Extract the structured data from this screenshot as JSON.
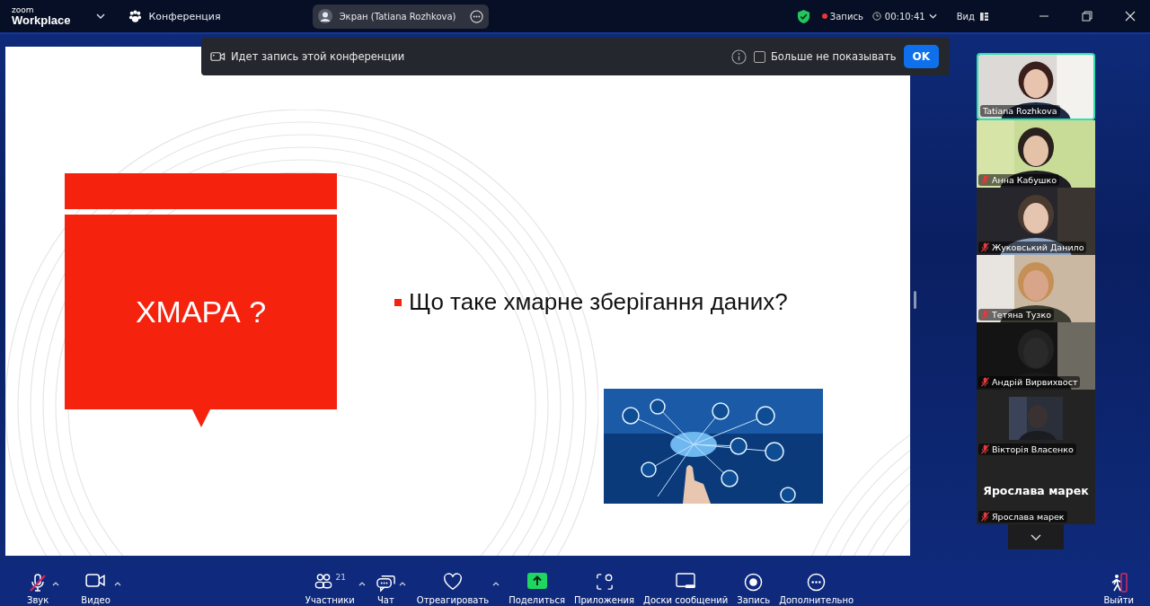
{
  "top_bar": {
    "logo_small": "zoom",
    "logo": "Workplace",
    "meeting_label": "Конференция",
    "share_pill": "Экран (Tatiana Rozhkova)",
    "recording": "Запись",
    "timer": "00:10:41",
    "view": "Вид"
  },
  "notice": {
    "text": "Идет запись этой конференции",
    "checkbox": {
      "label": "Больше не показывать",
      "checked": false
    },
    "button": "OK"
  },
  "slide": {
    "title": "ХМАРА ?",
    "bullet": "Що таке хмарне зберігання даних?"
  },
  "participants": [
    {
      "name": "Tatiana Rozhkova",
      "kind": "video",
      "muted": false,
      "speaking": true
    },
    {
      "name": "Анна Кабушко",
      "kind": "video",
      "muted": true,
      "speaking": false
    },
    {
      "name": "Жуковський Данило",
      "kind": "video",
      "muted": true,
      "speaking": false
    },
    {
      "name": "Тетяна Тузко",
      "kind": "video",
      "muted": true,
      "speaking": false
    },
    {
      "name": "Андрій Вирвихвост",
      "kind": "video",
      "muted": true,
      "speaking": false
    },
    {
      "name": "Вікторія Власенко",
      "kind": "thumbnail",
      "muted": true,
      "speaking": false
    },
    {
      "name": "Ярослава марек",
      "kind": "name",
      "display_name": "Ярослава марек",
      "muted": true,
      "speaking": false
    }
  ],
  "toolbar": [
    {
      "kind": "mic",
      "label": "Звук",
      "muted": true,
      "menu": true
    },
    {
      "kind": "video",
      "label": "Видео",
      "menu": true
    },
    {
      "kind": "participants",
      "label": "Участники",
      "count": "21",
      "menu": true
    },
    {
      "kind": "chat",
      "label": "Чат",
      "menu": true
    },
    {
      "kind": "react",
      "label": "Отреагировать",
      "menu": true
    },
    {
      "kind": "share",
      "label": "Поделиться",
      "menu": false
    },
    {
      "kind": "apps",
      "label": "Приложения",
      "menu": false
    },
    {
      "kind": "board",
      "label": "Доски сообщений",
      "menu": false
    },
    {
      "kind": "record",
      "label": "Запись",
      "menu": false
    },
    {
      "kind": "more",
      "label": "Дополнительно",
      "menu": false
    }
  ],
  "exit": "Выйти"
}
